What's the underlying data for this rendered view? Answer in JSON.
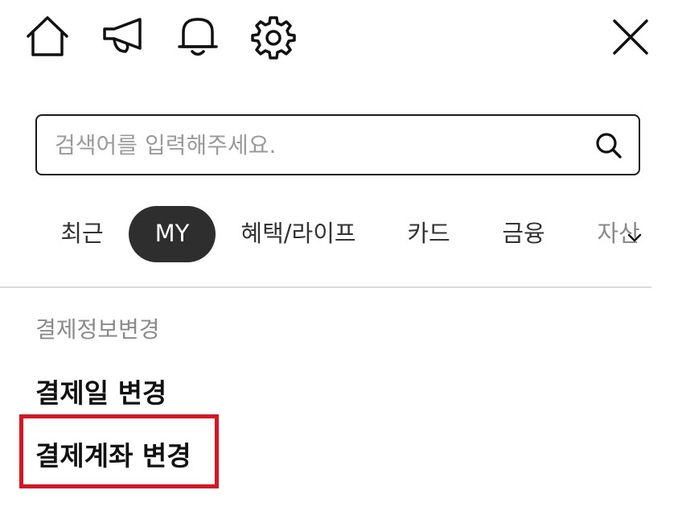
{
  "header": {
    "icons": {
      "home": "home-icon",
      "notice": "megaphone-icon",
      "alarm": "bell-icon",
      "settings": "gear-icon",
      "close": "close-icon"
    }
  },
  "search": {
    "placeholder": "검색어를 입력해주세요.",
    "icon": "search-icon"
  },
  "tabs": [
    {
      "label": "최근"
    },
    {
      "label": "MY"
    },
    {
      "label": "혜택/라이프"
    },
    {
      "label": "카드"
    },
    {
      "label": "금융"
    },
    {
      "label": "자산"
    }
  ],
  "active_tab": "MY",
  "section": {
    "title": "결제정보변경",
    "items": [
      {
        "label": "결제일 변경"
      },
      {
        "label": "결제계좌 변경"
      }
    ]
  },
  "colors": {
    "active_tab_bg": "#2e2e2e",
    "highlight": "#e3111f",
    "border": "#1a1a1a"
  }
}
